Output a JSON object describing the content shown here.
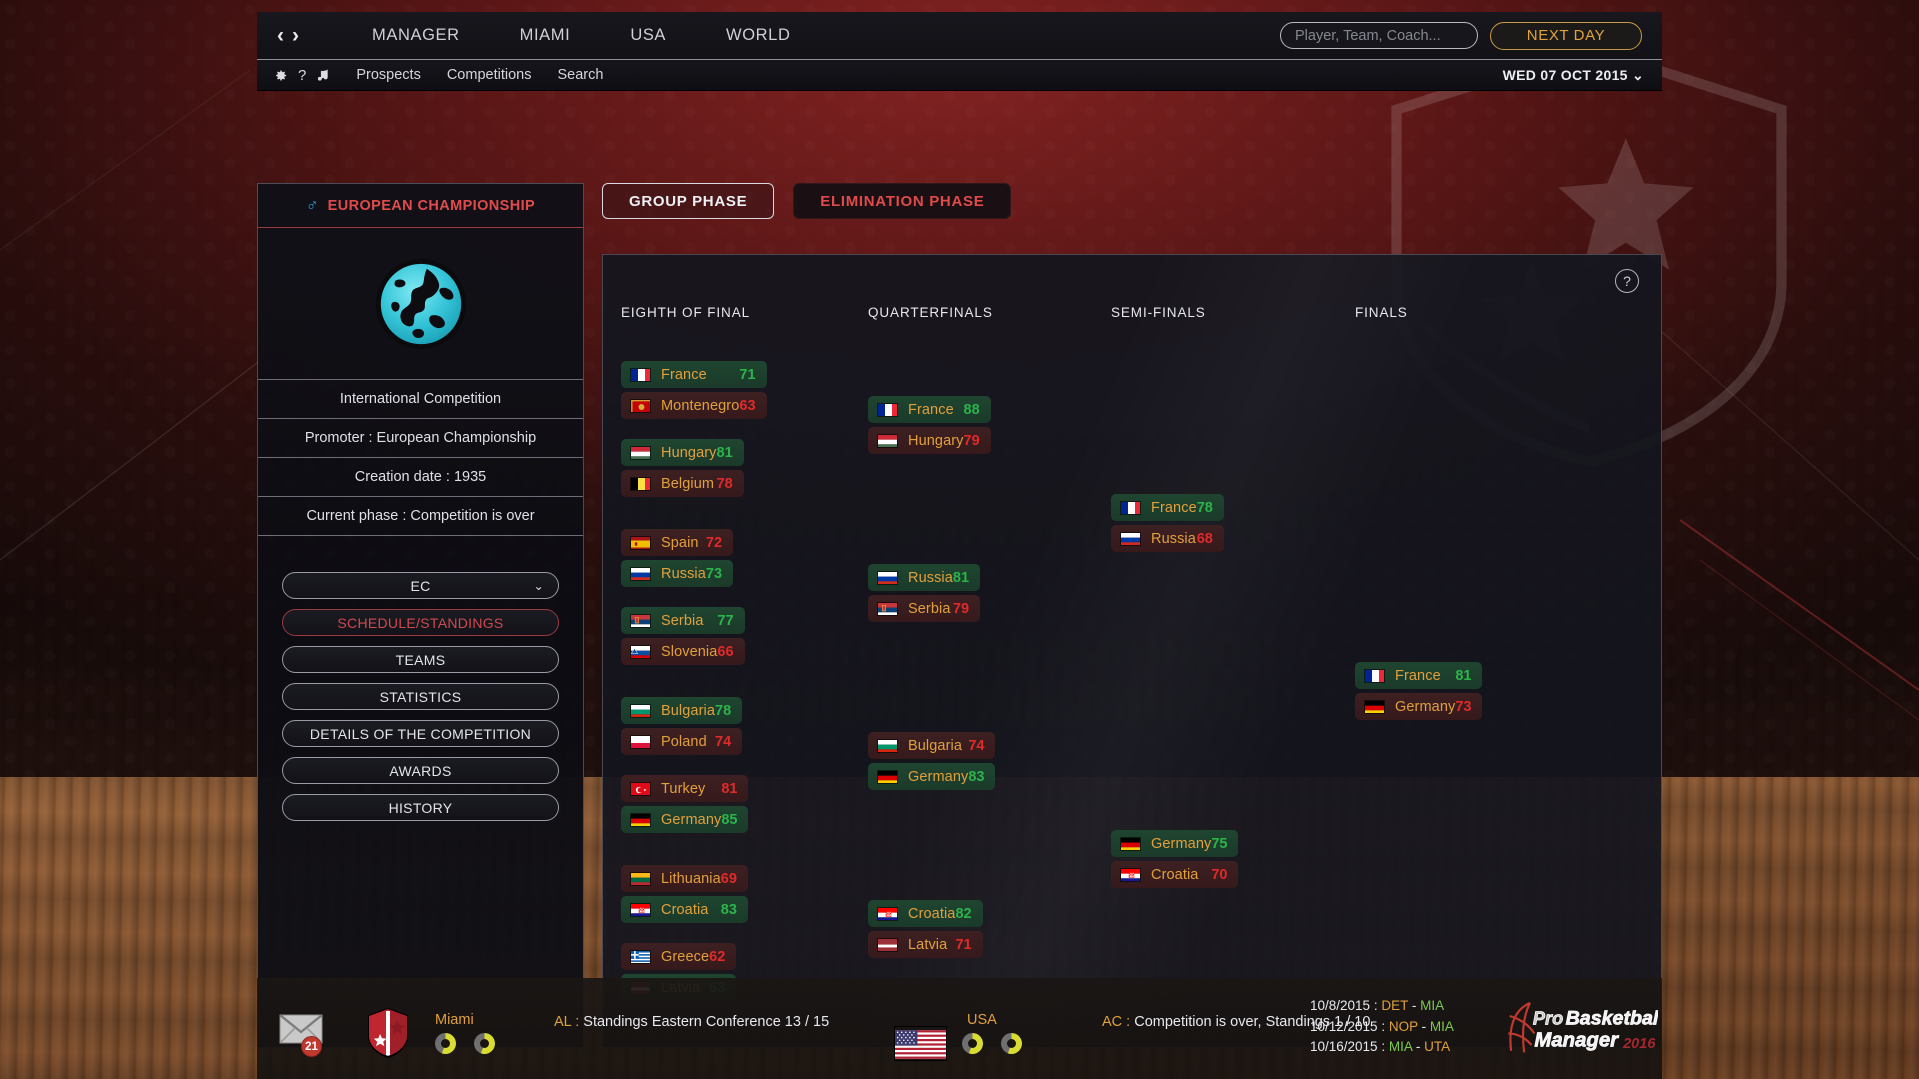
{
  "topbar": {
    "nav_prev": "‹",
    "nav_next": "›",
    "items": [
      {
        "label": "MANAGER"
      },
      {
        "label": "MIAMI"
      },
      {
        "label": "USA"
      },
      {
        "label": "WORLD"
      }
    ],
    "search_placeholder": "Player, Team, Coach...",
    "search_value": "",
    "next_day_label": "NEXT DAY"
  },
  "subbar": {
    "gear_icon": "gear-icon",
    "help_icon": "question-icon",
    "music_icon": "music-note-icon",
    "links": [
      {
        "label": "Prospects"
      },
      {
        "label": "Competitions"
      },
      {
        "label": "Search"
      }
    ],
    "date": "WED 07 OCT 2015",
    "date_chevron": "⌄"
  },
  "left_panel": {
    "gender_icon": "♂",
    "title": "EUROPEAN CHAMPIONSHIP",
    "logo_alt": "europe-globe-logo",
    "rows": [
      "International Competition",
      "Promoter : European Championship",
      "Creation date : 1935",
      "Current phase : Competition is over"
    ],
    "buttons": [
      {
        "label": "EC",
        "type": "select",
        "selected": false,
        "chevron": "⌄"
      },
      {
        "label": "SCHEDULE/STANDINGS",
        "type": "button",
        "selected": true
      },
      {
        "label": "TEAMS",
        "type": "button",
        "selected": false
      },
      {
        "label": "STATISTICS",
        "type": "button",
        "selected": false
      },
      {
        "label": "DETAILS OF THE COMPETITION",
        "type": "button",
        "selected": false
      },
      {
        "label": "AWARDS",
        "type": "button",
        "selected": false
      },
      {
        "label": "HISTORY",
        "type": "button",
        "selected": false
      }
    ]
  },
  "phase_tabs": [
    {
      "label": "GROUP PHASE",
      "active": true
    },
    {
      "label": "ELIMINATION PHASE",
      "active": false
    }
  ],
  "bracket": {
    "help_label": "?",
    "rounds": [
      {
        "name": "EIGHTH OF FINAL"
      },
      {
        "name": "QUARTERFINALS"
      },
      {
        "name": "SEMI-FINALS"
      },
      {
        "name": "FINALS"
      }
    ],
    "matches": {
      "eighth": [
        {
          "teams": [
            {
              "name": "France",
              "flag": "FR",
              "score": "71",
              "winner": true
            },
            {
              "name": "Montenegro",
              "flag": "ME",
              "score": "63",
              "winner": false
            }
          ]
        },
        {
          "teams": [
            {
              "name": "Hungary",
              "flag": "HU",
              "score": "81",
              "winner": true
            },
            {
              "name": "Belgium",
              "flag": "BE",
              "score": "78",
              "winner": false
            }
          ]
        },
        {
          "teams": [
            {
              "name": "Spain",
              "flag": "ES",
              "score": "72",
              "winner": false
            },
            {
              "name": "Russia",
              "flag": "RU",
              "score": "73",
              "winner": true
            }
          ]
        },
        {
          "teams": [
            {
              "name": "Serbia",
              "flag": "RS",
              "score": "77",
              "winner": true
            },
            {
              "name": "Slovenia",
              "flag": "SI",
              "score": "66",
              "winner": false
            }
          ]
        },
        {
          "teams": [
            {
              "name": "Bulgaria",
              "flag": "BG",
              "score": "78",
              "winner": true
            },
            {
              "name": "Poland",
              "flag": "PL",
              "score": "74",
              "winner": false
            }
          ]
        },
        {
          "teams": [
            {
              "name": "Turkey",
              "flag": "TR",
              "score": "81",
              "winner": false
            },
            {
              "name": "Germany",
              "flag": "DE",
              "score": "85",
              "winner": true
            }
          ]
        },
        {
          "teams": [
            {
              "name": "Lithuania",
              "flag": "LT",
              "score": "69",
              "winner": false
            },
            {
              "name": "Croatia",
              "flag": "HR",
              "score": "83",
              "winner": true
            }
          ]
        },
        {
          "teams": [
            {
              "name": "Greece",
              "flag": "GR",
              "score": "62",
              "winner": false
            },
            {
              "name": "Latvia",
              "flag": "LV",
              "score": "63",
              "winner": true
            }
          ]
        }
      ],
      "quarter": [
        {
          "teams": [
            {
              "name": "France",
              "flag": "FR",
              "score": "88",
              "winner": true
            },
            {
              "name": "Hungary",
              "flag": "HU",
              "score": "79",
              "winner": false
            }
          ]
        },
        {
          "teams": [
            {
              "name": "Russia",
              "flag": "RU",
              "score": "81",
              "winner": true
            },
            {
              "name": "Serbia",
              "flag": "RS",
              "score": "79",
              "winner": false
            }
          ]
        },
        {
          "teams": [
            {
              "name": "Bulgaria",
              "flag": "BG",
              "score": "74",
              "winner": false
            },
            {
              "name": "Germany",
              "flag": "DE",
              "score": "83",
              "winner": true
            }
          ]
        },
        {
          "teams": [
            {
              "name": "Croatia",
              "flag": "HR",
              "score": "82",
              "winner": true
            },
            {
              "name": "Latvia",
              "flag": "LV",
              "score": "71",
              "winner": false
            }
          ]
        }
      ],
      "semi": [
        {
          "teams": [
            {
              "name": "France",
              "flag": "FR",
              "score": "78",
              "winner": true
            },
            {
              "name": "Russia",
              "flag": "RU",
              "score": "68",
              "winner": false
            }
          ]
        },
        {
          "teams": [
            {
              "name": "Germany",
              "flag": "DE",
              "score": "75",
              "winner": true
            },
            {
              "name": "Croatia",
              "flag": "HR",
              "score": "70",
              "winner": false
            }
          ]
        }
      ],
      "final": [
        {
          "teams": [
            {
              "name": "France",
              "flag": "FR",
              "score": "81",
              "winner": true
            },
            {
              "name": "Germany",
              "flag": "DE",
              "score": "73",
              "winner": false
            }
          ]
        }
      ]
    }
  },
  "bottombar": {
    "mail_icon": "envelope-icon",
    "mail_count": "21",
    "club_shield_icon": "club-shield-icon",
    "team_name": "Miami",
    "team_status_prefix": "AL :",
    "team_status": "Standings Eastern Conference 13 / 15",
    "country_flag": "US",
    "country_name": "USA",
    "country_status_prefix": "AC :",
    "country_status": "Competition is over, Standings 1 / 10",
    "fixtures": [
      {
        "date": "10/8/2015",
        "sep": ":",
        "home": "DET",
        "dash": "-",
        "away": "MIA",
        "home_highlight": false,
        "away_highlight": true
      },
      {
        "date": "10/12/2015",
        "sep": ":",
        "home": "NOP",
        "dash": "-",
        "away": "MIA",
        "home_highlight": false,
        "away_highlight": true
      },
      {
        "date": "10/16/2015",
        "sep": ":",
        "home": "MIA",
        "dash": "-",
        "away": "UTA",
        "home_highlight": true,
        "away_highlight": false
      }
    ],
    "game_logo_line1": "Pro",
    "game_logo_line2": "Basketball",
    "game_logo_line3": "Manager",
    "game_logo_year": "2016"
  },
  "colors": {
    "accent_red": "#e24b4b",
    "accent_gold": "#e2a03c",
    "win_green": "#2cb34a",
    "lose_red": "#e02a2a"
  }
}
